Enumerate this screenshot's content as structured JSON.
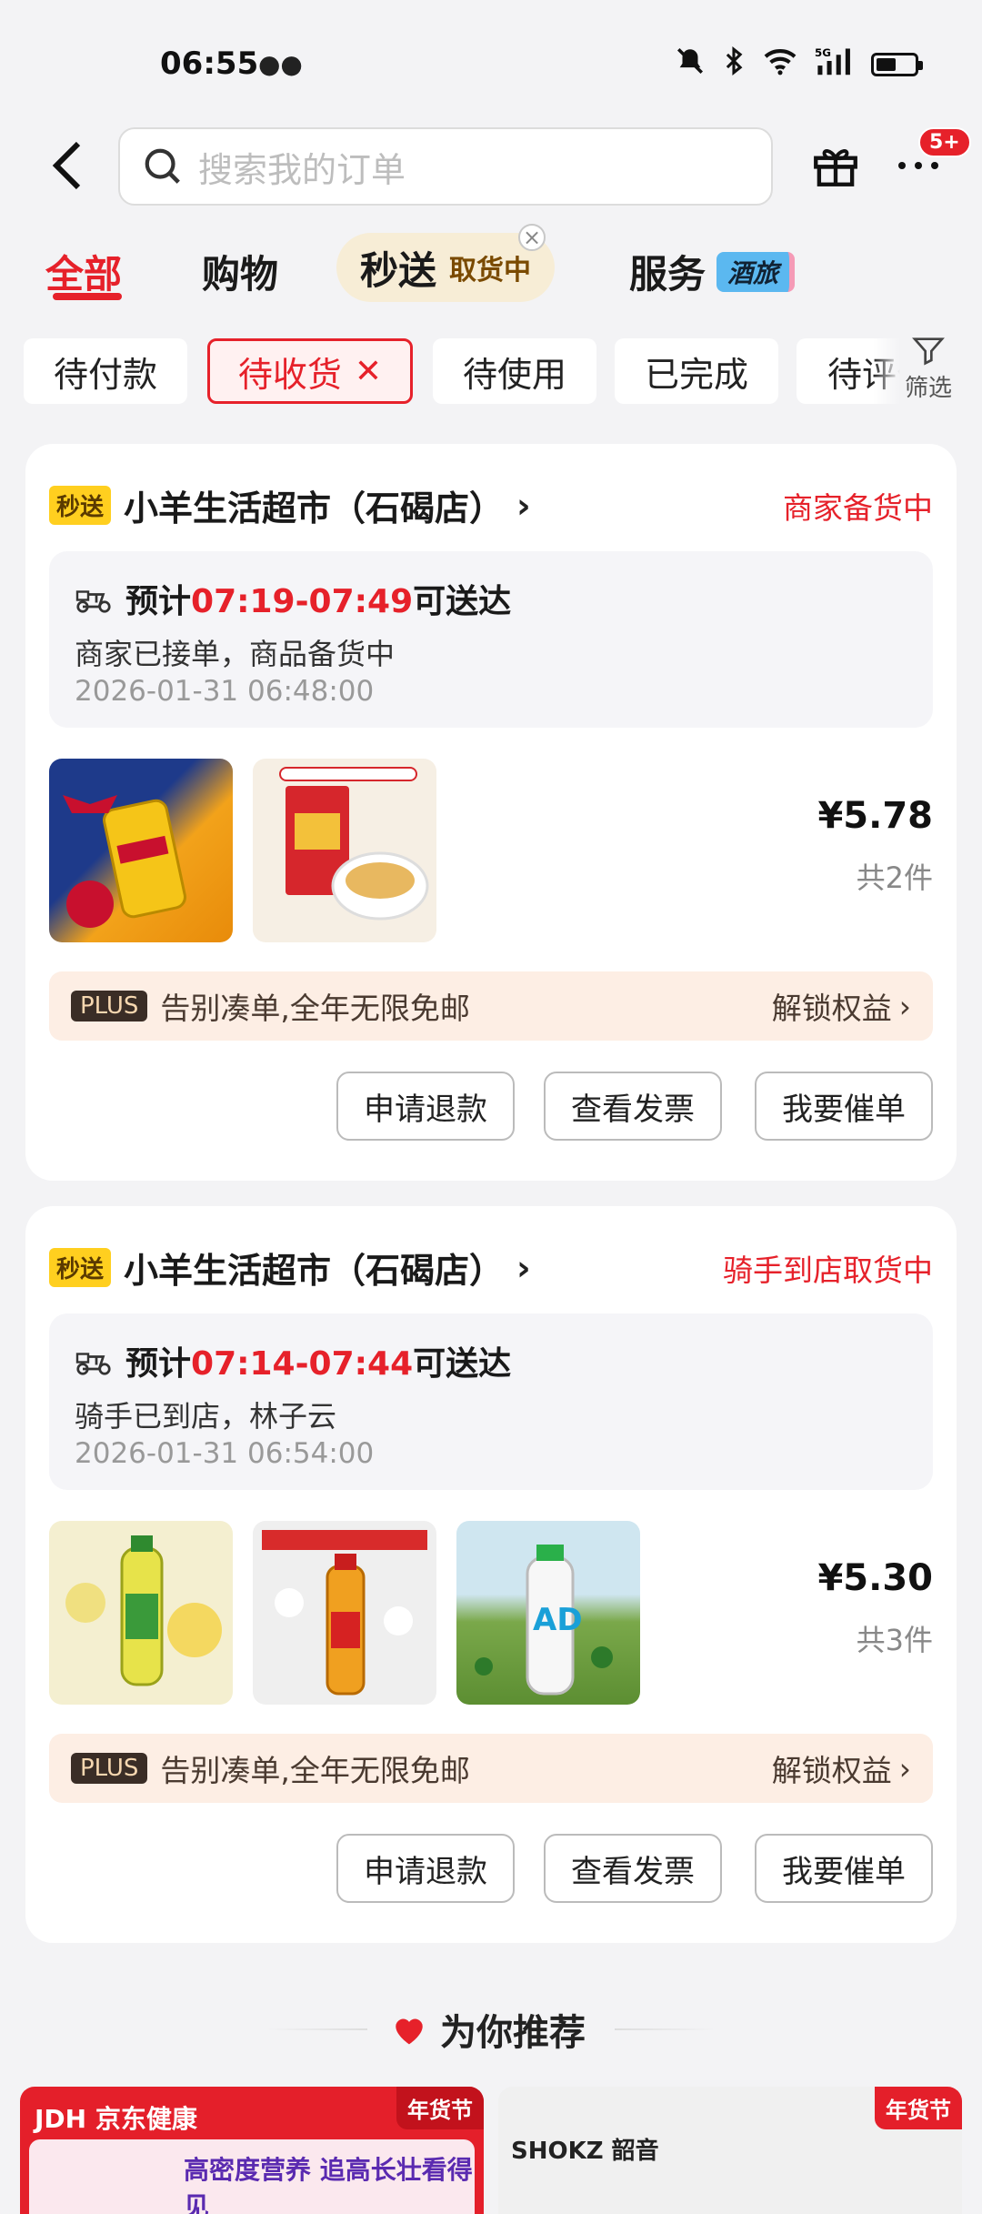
{
  "status_bar": {
    "time": "06:55"
  },
  "header": {
    "search_placeholder": "搜索我的订单",
    "notification_badge": "5+"
  },
  "tabs": {
    "all": "全部",
    "shopping": "购物",
    "flash": "秒送",
    "flash_sub": "取货中",
    "service": "服务",
    "service_tag": "酒旅"
  },
  "filters": [
    "待付款",
    "待收货",
    "待使用",
    "已完成",
    "待评价"
  ],
  "filter_label": "筛选",
  "orders": [
    {
      "tag": "秒送",
      "store": "小羊生活超市（石碣店）",
      "status": "商家备货中",
      "eta_prefix": "预计",
      "eta_time": "07:19-07:49",
      "eta_suffix": "可送达",
      "desc": "商家已接单，商品备货中",
      "date": "2026-01-31 06:48:00",
      "price": "¥5.78",
      "count": "共2件",
      "plus_tag": "PLUS",
      "plus_text": "告别凑单,全年无限免邮",
      "plus_link": "解锁权益",
      "buttons": [
        "申请退款",
        "查看发票",
        "我要催单"
      ]
    },
    {
      "tag": "秒送",
      "store": "小羊生活超市（石碣店）",
      "status": "骑手到店取货中",
      "eta_prefix": "预计",
      "eta_time": "07:14-07:44",
      "eta_suffix": "可送达",
      "desc": "骑手已到店，林子云",
      "date": "2026-01-31 06:54:00",
      "price": "¥5.30",
      "count": "共3件",
      "plus_tag": "PLUS",
      "plus_text": "告别凑单,全年无限免邮",
      "plus_link": "解锁权益",
      "buttons": [
        "申请退款",
        "查看发票",
        "我要催单"
      ]
    }
  ],
  "recommend": {
    "title": "为你推荐",
    "card1_brand": "JDH 京东健康",
    "card1_badge": "年货节",
    "card1_text": "高密度营养 追高长壮看得见",
    "card2_brand": "SHOKZ 韶音",
    "card2_badge": "年货节"
  }
}
